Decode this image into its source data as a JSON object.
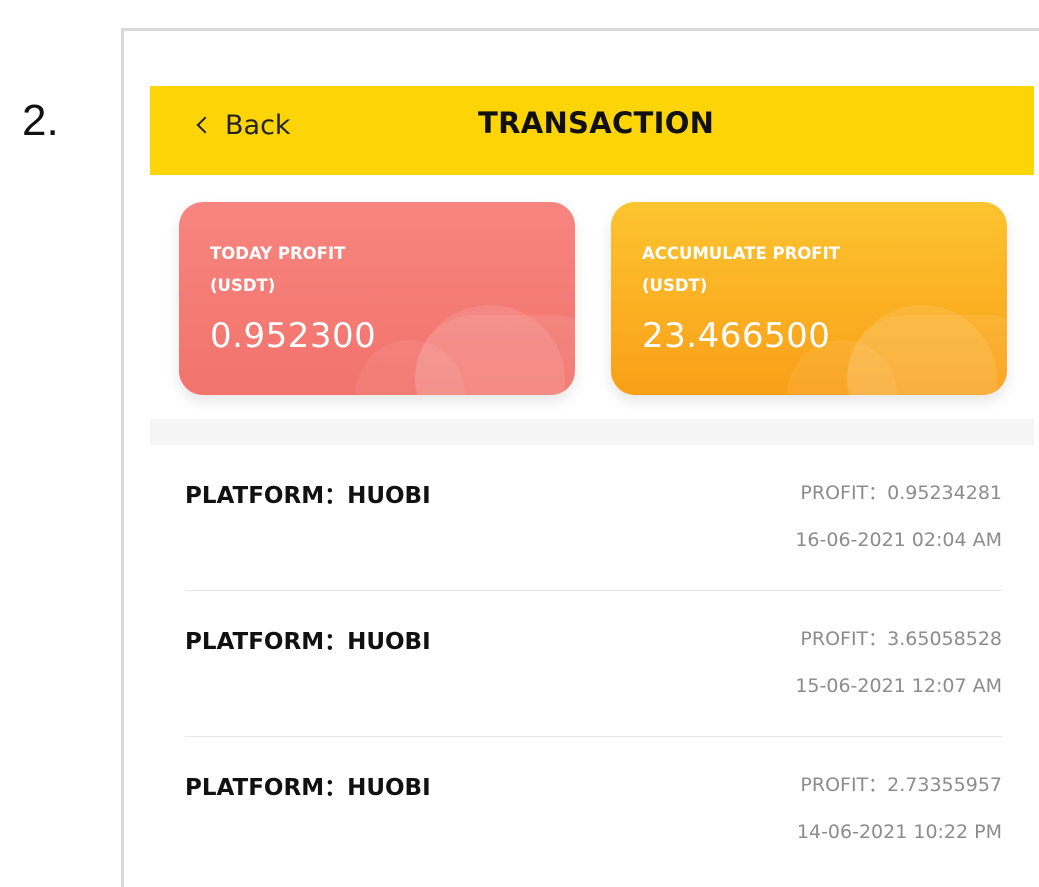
{
  "step_number": "2.",
  "header": {
    "back_label": "Back",
    "title": "TRANSACTION"
  },
  "cards": {
    "today": {
      "label_line1": "TODAY PROFIT",
      "label_line2": "(USDT)",
      "value": "0.952300"
    },
    "accumulate": {
      "label_line1": "ACCUMULATE PROFIT",
      "label_line2": "(USDT)",
      "value": "23.466500"
    }
  },
  "colors": {
    "header_bg": "#fdd506",
    "today_card": "#f47a73",
    "accumulate_card": "#fbb223"
  },
  "transactions": [
    {
      "platform": "PLATFORM：HUOBI",
      "profit": "PROFIT：0.95234281",
      "date": "16-06-2021 02:04 AM"
    },
    {
      "platform": "PLATFORM：HUOBI",
      "profit": "PROFIT：3.65058528",
      "date": "15-06-2021 12:07 AM"
    },
    {
      "platform": "PLATFORM：HUOBI",
      "profit": "PROFIT：2.73355957",
      "date": "14-06-2021 10:22 PM"
    }
  ],
  "icons": {
    "back": "chevron-left-icon"
  }
}
